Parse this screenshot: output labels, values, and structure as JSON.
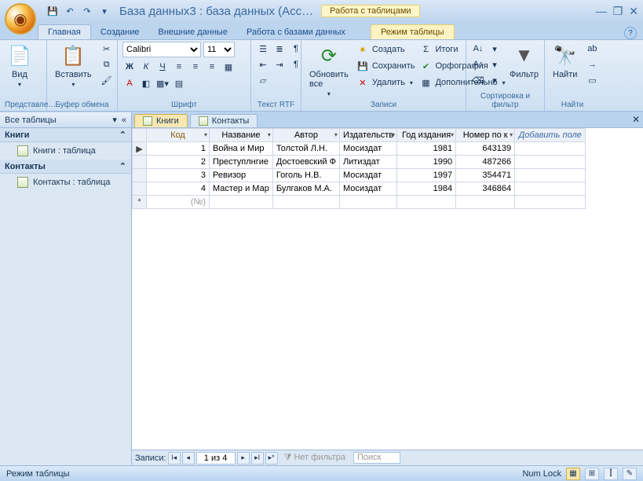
{
  "title": "База данных3 : база данных (Acc…",
  "contextual_group": "Работа с таблицами",
  "help_tooltip": "?",
  "qat": {
    "save": "💾",
    "undo": "↶",
    "redo": "↷",
    "more": "▾"
  },
  "window_controls": {
    "min": "—",
    "max": "❐",
    "close": "✕"
  },
  "ribbon_tabs": {
    "home": "Главная",
    "create": "Создание",
    "external": "Внешние данные",
    "dbtools": "Работа с базами данных",
    "datasheet": "Режим таблицы"
  },
  "ribbon": {
    "views": {
      "label": "Представле…",
      "view": "Вид"
    },
    "clipboard": {
      "label": "Буфер обмена",
      "paste": "Вставить"
    },
    "font": {
      "label": "Шрифт",
      "name": "Calibri",
      "size": "11",
      "bold": "Ж",
      "italic": "К",
      "underline": "Ч"
    },
    "richtext": {
      "label": "Текст RTF"
    },
    "records": {
      "label": "Записи",
      "refresh": "Обновить все",
      "new": "Создать",
      "save": "Сохранить",
      "delete": "Удалить",
      "totals": "Итоги",
      "spelling": "Орфография",
      "more": "Дополнительно"
    },
    "sortfilter": {
      "label": "Сортировка и фильтр",
      "filter": "Фильтр"
    },
    "find": {
      "label": "Найти",
      "find": "Найти"
    }
  },
  "navpane": {
    "header": "Все таблицы",
    "groups": [
      {
        "title": "Книги",
        "items": [
          {
            "label": "Книги : таблица"
          }
        ]
      },
      {
        "title": "Контакты",
        "items": [
          {
            "label": "Контакты : таблица"
          }
        ]
      }
    ]
  },
  "doctabs": {
    "active": "Книги",
    "other": "Контакты"
  },
  "columns": {
    "code": "Код",
    "name": "Название",
    "author": "Автор",
    "publisher": "Издательств",
    "year": "Год издания",
    "catalog": "Номер по к",
    "add": "Добавить поле"
  },
  "rows": [
    {
      "code": "1",
      "name": "Война и Мир",
      "author": "Толстой Л.Н.",
      "publisher": "Мосиздат",
      "year": "1981",
      "catalog": "643139"
    },
    {
      "code": "2",
      "name": "Преступлнгие",
      "author": "Достоевский Ф",
      "publisher": "Литиздат",
      "year": "1990",
      "catalog": "487266"
    },
    {
      "code": "3",
      "name": "Ревизор",
      "author": "Гоголь Н.В.",
      "publisher": "Мосиздат",
      "year": "1997",
      "catalog": "354471"
    },
    {
      "code": "4",
      "name": "Мастер и Мар",
      "author": "Булгаков М.А.",
      "publisher": "Мосиздат",
      "year": "1984",
      "catalog": "346864"
    }
  ],
  "newrow_placeholder": "(№)",
  "recnav": {
    "label": "Записи:",
    "position": "1 из 4",
    "nofilter": "Нет фильтра",
    "search": "Поиск"
  },
  "status": {
    "mode": "Режим таблицы",
    "numlock": "Num Lock"
  }
}
